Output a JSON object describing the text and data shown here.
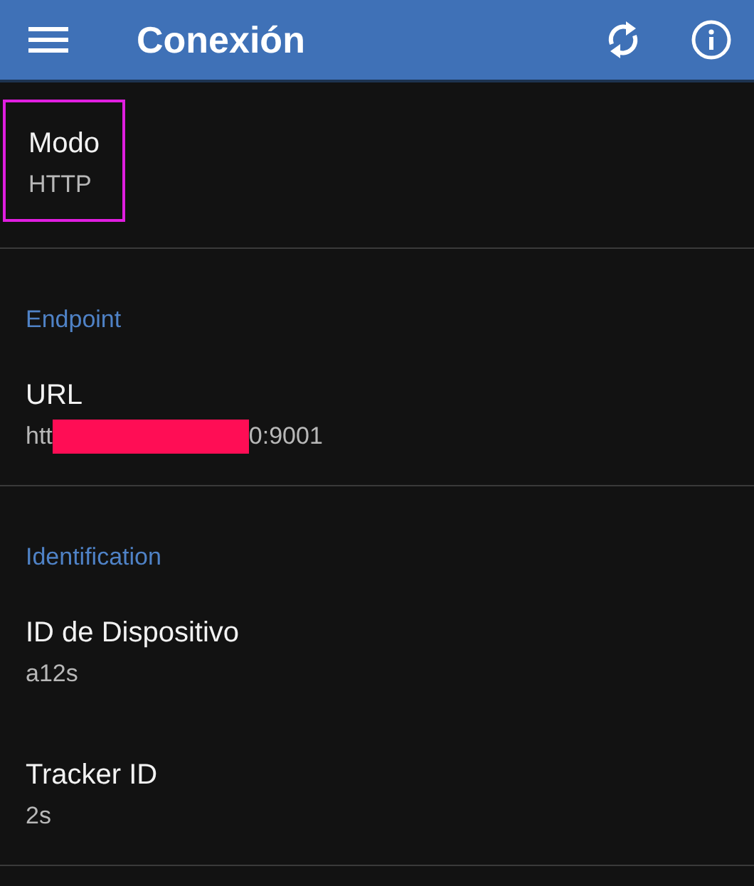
{
  "app_bar": {
    "title": "Conexión"
  },
  "sections": [
    {
      "items": [
        {
          "title": "Modo",
          "value": "HTTP",
          "highlighted": true
        }
      ]
    },
    {
      "header": "Endpoint",
      "items": [
        {
          "title": "URL",
          "value_start": "htt",
          "value_end": "0:9001",
          "redacted": true
        }
      ]
    },
    {
      "header": "Identification",
      "items": [
        {
          "title": "ID de Dispositivo",
          "value": "a12s",
          "highlighted": false
        },
        {
          "title": "Tracker ID",
          "value": "2s",
          "highlighted": false
        }
      ]
    }
  ]
}
